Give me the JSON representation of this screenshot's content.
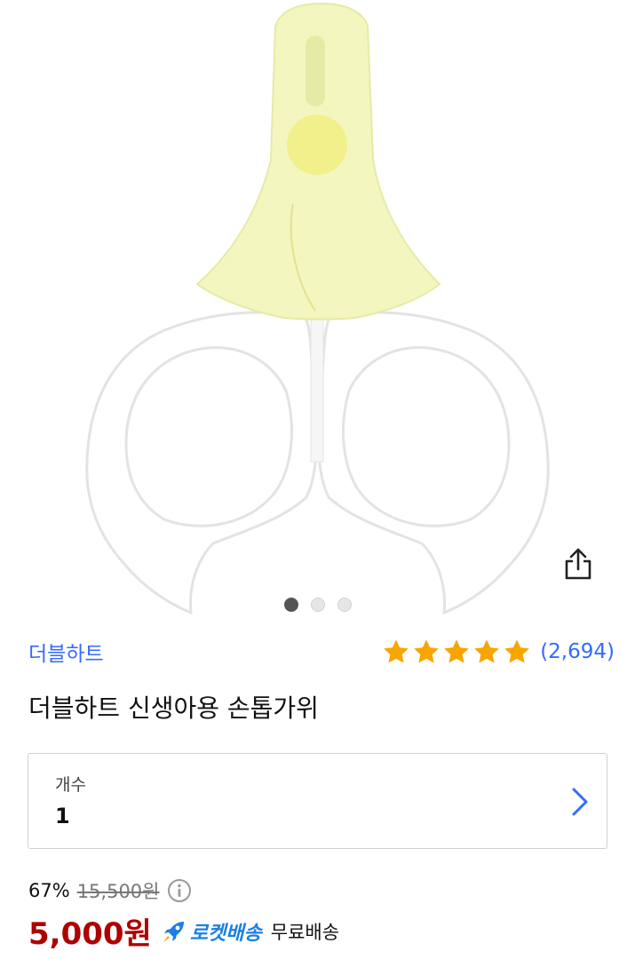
{
  "product": {
    "brand": "더블하트",
    "title": "더블하트 신생아용 손톱가위",
    "rating_stars": 5,
    "review_count": "(2,694)"
  },
  "gallery": {
    "image_count": 3,
    "active_index": 0,
    "image_subject": "scissors-image"
  },
  "quantity": {
    "label": "개수",
    "value": "1"
  },
  "pricing": {
    "discount": "67%",
    "original_price": "15,500원",
    "sale_price": "5,000원",
    "delivery_badge": "로켓배송",
    "shipping": "무료배송"
  },
  "colors": {
    "accent_blue": "#346aff",
    "star_gold": "#f9a500",
    "price_red": "#ae0000",
    "rocket_blue": "#1b7fe3"
  }
}
